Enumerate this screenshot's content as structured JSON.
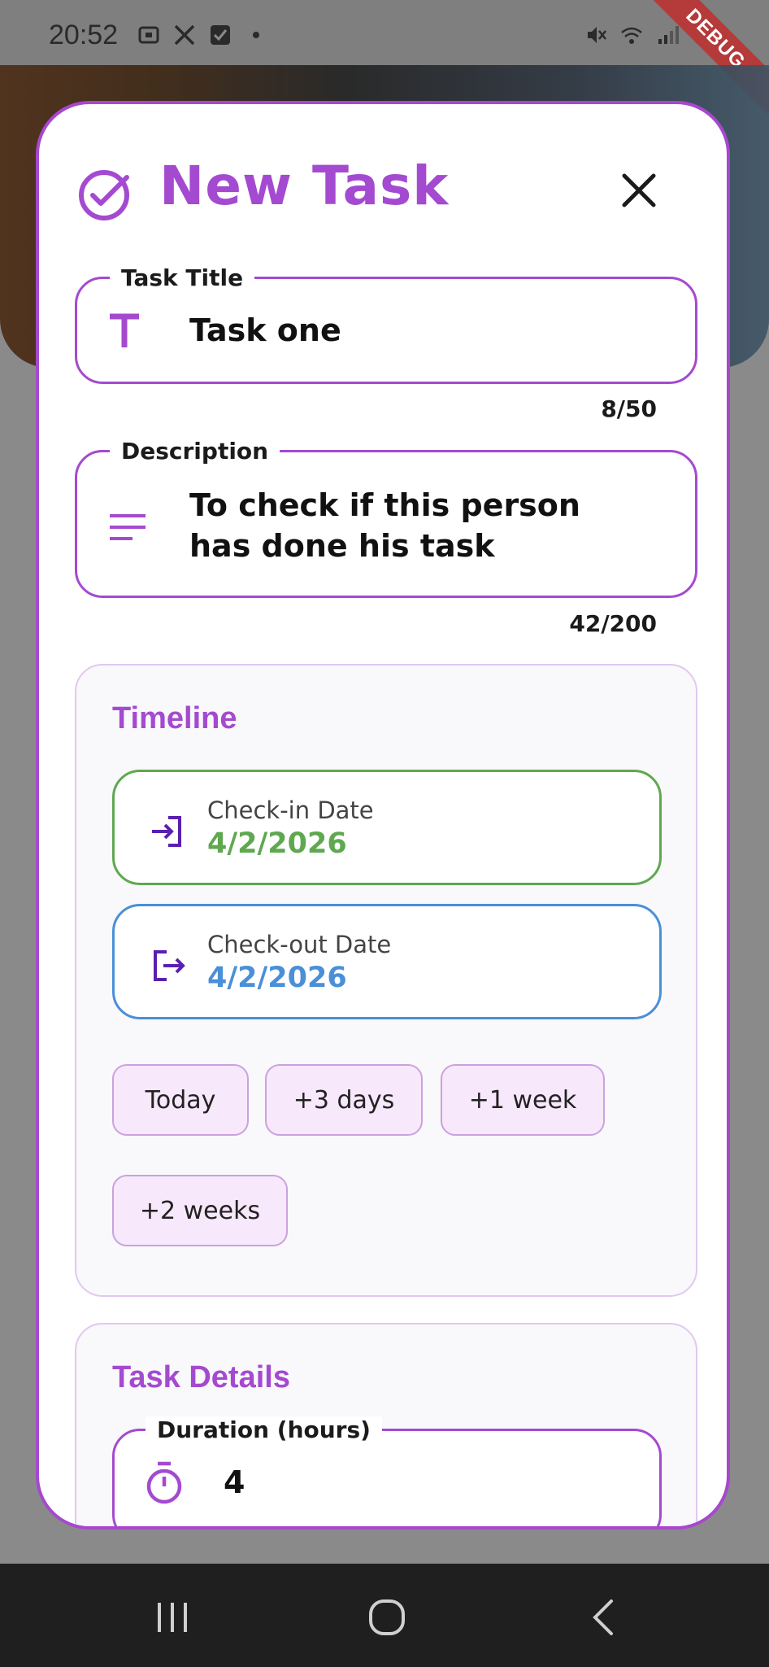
{
  "status_bar": {
    "time": "20:52",
    "left_icons": [
      "screenshot-icon",
      "x-app-icon",
      "check-box-icon",
      "dot-icon"
    ],
    "right_icons": [
      "mute-icon",
      "wifi-icon",
      "signal-icon",
      "battery-icon"
    ],
    "debug_label": "DEBUG"
  },
  "header": {
    "title": "New Task",
    "icon": "check-circle-icon",
    "close_icon": "close-icon"
  },
  "task_title": {
    "label": "Task Title",
    "value": "Task one",
    "counter": "8/50",
    "icon": "title-t-icon"
  },
  "description": {
    "label": "Description",
    "value": "To check if this person has done his task",
    "counter": "42/200",
    "icon": "notes-lines-icon"
  },
  "timeline": {
    "title": "Timeline",
    "check_in": {
      "label": "Check-in Date",
      "value": "4/2/2026",
      "color": "#5fa84f",
      "icon": "login-icon"
    },
    "check_out": {
      "label": "Check-out Date",
      "value": "4/2/2026",
      "color": "#4a8fd8",
      "icon": "logout-icon"
    },
    "quick_picks": [
      "Today",
      "+3 days",
      "+1 week",
      "+2 weeks"
    ]
  },
  "task_details": {
    "title": "Task Details",
    "duration": {
      "label": "Duration (hours)",
      "value": "4",
      "icon": "timer-icon"
    }
  },
  "nav_bar": {
    "buttons": [
      "recent-apps-icon",
      "home-icon",
      "back-icon"
    ]
  },
  "colors": {
    "accent": "#a44ad0",
    "check_in": "#5fa84f",
    "check_out": "#4a8fd8",
    "icon_dark_purple": "#5a1fb0"
  }
}
